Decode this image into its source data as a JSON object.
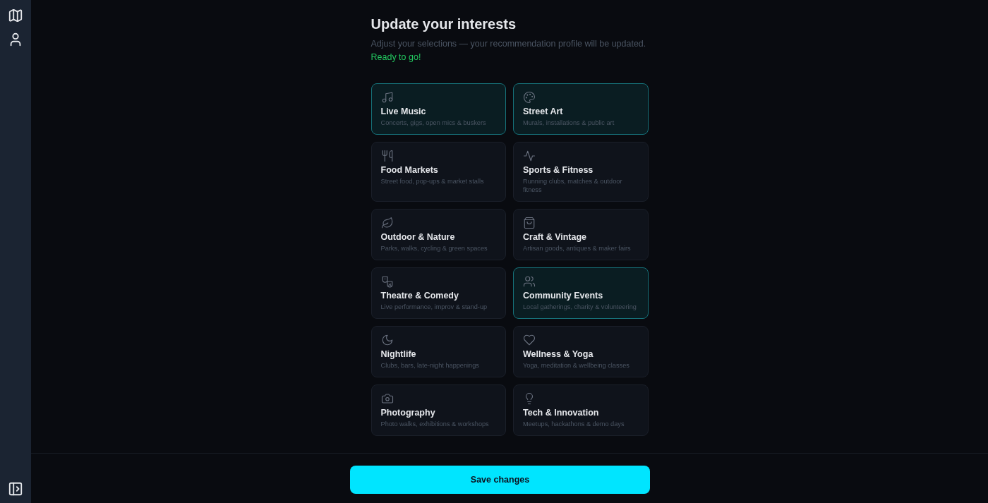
{
  "header": {
    "title": "Update your interests",
    "subtitle": "Adjust your selections — your recommendation profile will be updated.",
    "status": "Ready to go!"
  },
  "interests": [
    {
      "title": "Live Music",
      "description": "Concerts, gigs, open mics & buskers",
      "selected": true
    },
    {
      "title": "Street Art",
      "description": "Murals, installations & public art",
      "selected": true
    },
    {
      "title": "Food Markets",
      "description": "Street food, pop-ups & market stalls",
      "selected": false
    },
    {
      "title": "Sports & Fitness",
      "description": "Running clubs, matches & outdoor fitness",
      "selected": false
    },
    {
      "title": "Outdoor & Nature",
      "description": "Parks, walks, cycling & green spaces",
      "selected": false
    },
    {
      "title": "Craft & Vintage",
      "description": "Artisan goods, antiques & maker fairs",
      "selected": false
    },
    {
      "title": "Theatre & Comedy",
      "description": "Live performance, improv & stand-up",
      "selected": false
    },
    {
      "title": "Community Events",
      "description": "Local gatherings, charity & volunteering",
      "selected": true
    },
    {
      "title": "Nightlife",
      "description": "Clubs, bars, late-night happenings",
      "selected": false
    },
    {
      "title": "Wellness & Yoga",
      "description": "Yoga, meditation & wellbeing classes",
      "selected": false
    },
    {
      "title": "Photography",
      "description": "Photo walks, exhibitions & workshops",
      "selected": false
    },
    {
      "title": "Tech & Innovation",
      "description": "Meetups, hackathons & demo days",
      "selected": false
    }
  ],
  "footer": {
    "save_button": "Save changes"
  }
}
